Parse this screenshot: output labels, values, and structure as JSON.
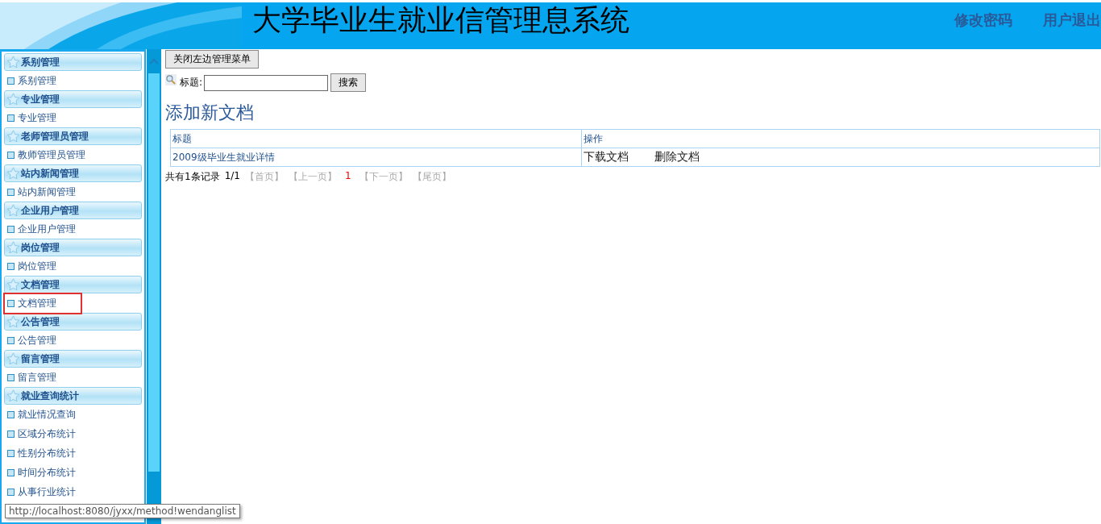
{
  "header": {
    "title": "大学毕业生就业信管理息系统",
    "links": [
      "修改密码",
      "用户退出"
    ]
  },
  "sidebar": {
    "groups": [
      {
        "title": "系别管理",
        "items": [
          {
            "label": "系别管理",
            "selected": false
          }
        ]
      },
      {
        "title": "专业管理",
        "items": [
          {
            "label": "专业管理",
            "selected": false
          }
        ]
      },
      {
        "title": "老师管理员管理",
        "items": [
          {
            "label": "教师管理员管理",
            "selected": false
          }
        ]
      },
      {
        "title": "站内新闻管理",
        "items": [
          {
            "label": "站内新闻管理",
            "selected": false
          }
        ]
      },
      {
        "title": "企业用户管理",
        "items": [
          {
            "label": "企业用户管理",
            "selected": false
          }
        ]
      },
      {
        "title": "岗位管理",
        "items": [
          {
            "label": "岗位管理",
            "selected": false
          }
        ]
      },
      {
        "title": "文档管理",
        "items": [
          {
            "label": "文档管理",
            "selected": true
          }
        ]
      },
      {
        "title": "公告管理",
        "items": [
          {
            "label": "公告管理",
            "selected": false
          }
        ]
      },
      {
        "title": "留言管理",
        "items": [
          {
            "label": "留言管理",
            "selected": false
          }
        ]
      },
      {
        "title": "就业查询统计",
        "items": [
          {
            "label": "就业情况查询",
            "selected": false
          },
          {
            "label": "区域分布统计",
            "selected": false
          },
          {
            "label": "性别分布统计",
            "selected": false
          },
          {
            "label": "时间分布统计",
            "selected": false
          },
          {
            "label": "从事行业统计",
            "selected": false
          }
        ]
      }
    ]
  },
  "toggle_button": "关闭左边管理菜单",
  "search": {
    "label": "标题:",
    "button": "搜索"
  },
  "page_title": "添加新文档",
  "table": {
    "columns": [
      "标题",
      "操作"
    ],
    "rows": [
      {
        "title": "2009级毕业生就业详情",
        "actions": [
          "下载文档",
          "删除文档"
        ]
      }
    ]
  },
  "pager": {
    "summary": "共有1条记录",
    "page_of": "1/1",
    "first": "【首页】",
    "prev": "【上一页】",
    "current": "1",
    "next": "【下一页】",
    "last": "【尾页】"
  },
  "status_tooltip": "http://localhost:8080/jyxx/method!wendanglist"
}
